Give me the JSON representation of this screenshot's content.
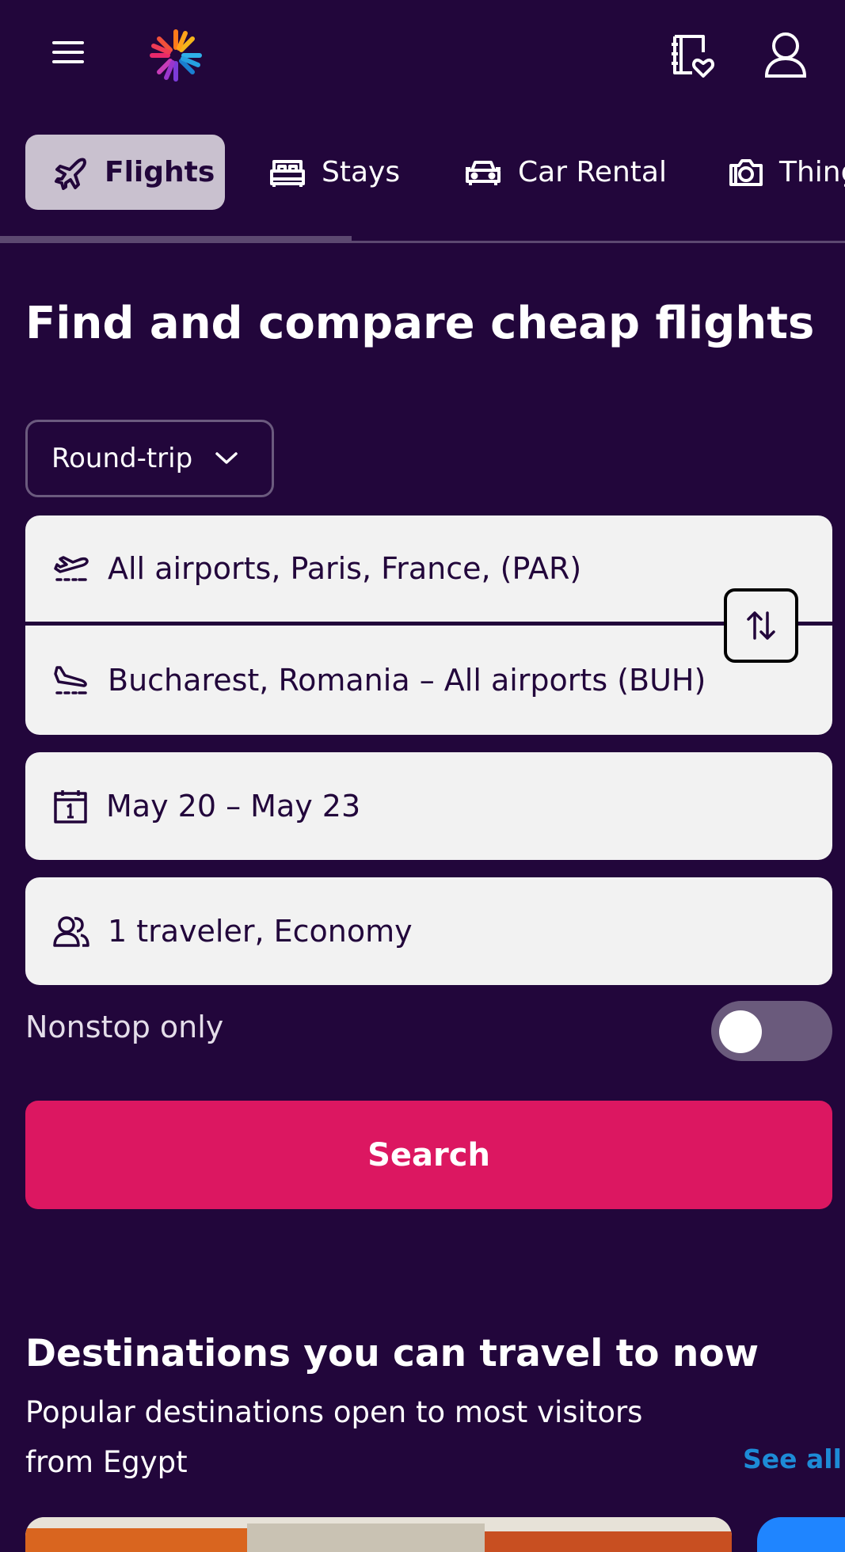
{
  "header": {
    "menu_icon": "hamburger-icon",
    "logo_icon": "pinwheel-logo-icon",
    "trips_icon": "saved-trips-icon",
    "account_icon": "account-icon"
  },
  "tabs": [
    {
      "label": "Flights",
      "icon": "plane-icon",
      "active": true
    },
    {
      "label": "Stays",
      "icon": "bed-icon",
      "active": false
    },
    {
      "label": "Car Rental",
      "icon": "car-icon",
      "active": false
    },
    {
      "label": "Things to do",
      "icon": "camera-icon",
      "active": false
    }
  ],
  "page_title": "Find and compare cheap flights",
  "search_form": {
    "trip_type": "Round-trip",
    "origin": "All airports, Paris, France, (PAR)",
    "destination": "Bucharest, Romania – All airports (BUH)",
    "dates": "May 20 – May 23",
    "travelers": "1 traveler, Economy",
    "nonstop_label": "Nonstop only",
    "nonstop_enabled": false,
    "search_label": "Search"
  },
  "destinations": {
    "title": "Destinations you can travel to now",
    "subtitle": "Popular destinations open to most visitors from Egypt",
    "see_all": "See all"
  },
  "colors": {
    "background": "#22063b",
    "search_button": "#dc1761",
    "link": "#1d8bd6",
    "field": "#f2f2f2"
  }
}
